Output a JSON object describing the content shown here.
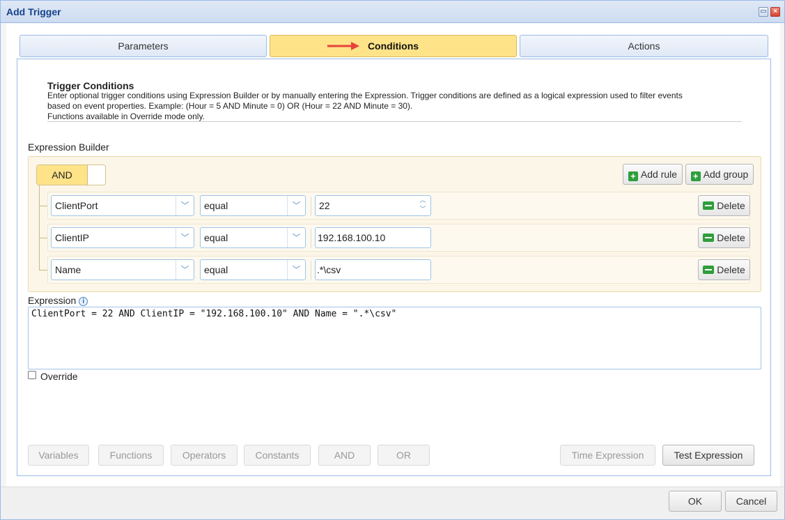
{
  "window": {
    "title": "Add Trigger",
    "restore_icon": "restore-icon",
    "close_icon": "close-icon"
  },
  "tabs": [
    {
      "label": "Parameters"
    },
    {
      "label": "Conditions"
    },
    {
      "label": "Actions"
    }
  ],
  "conditions": {
    "heading": "Trigger Conditions",
    "description_line1": "Enter optional trigger conditions using Expression Builder or by manually entering the Expression. Trigger conditions are defined as a logical expression used to filter events",
    "description_line2": "based on event properties. Example: (Hour = 5 AND Minute = 0) OR (Hour = 22 AND Minute = 30).",
    "description_line3": "Functions available in Override mode only.",
    "builder_label": "Expression Builder",
    "group_operator": "AND",
    "add_rule_label": "Add rule",
    "add_group_label": "Add group",
    "delete_label": "Delete",
    "rules": [
      {
        "field": "ClientPort",
        "operator": "equal",
        "value": "22"
      },
      {
        "field": "ClientIP",
        "operator": "equal",
        "value": "192.168.100.10"
      },
      {
        "field": "Name",
        "operator": "equal",
        "value": ".*\\csv"
      }
    ],
    "expression_label": "Expression",
    "expression_value": "ClientPort = 22 AND ClientIP = \"192.168.100.10\" AND Name = \".*\\csv\"",
    "override_label": "Override",
    "override_checked": false
  },
  "toolbar": {
    "variables": "Variables",
    "functions": "Functions",
    "operators": "Operators",
    "constants": "Constants",
    "and": "AND",
    "or": "OR",
    "time_expression": "Time Expression",
    "test_expression": "Test Expression"
  },
  "footer": {
    "ok": "OK",
    "cancel": "Cancel"
  },
  "colors": {
    "active_tab": "#ffe389",
    "builder_bg": "#fcf6e8",
    "accent_green": "#2e9e3b",
    "arrow_red": "#e8423a"
  }
}
